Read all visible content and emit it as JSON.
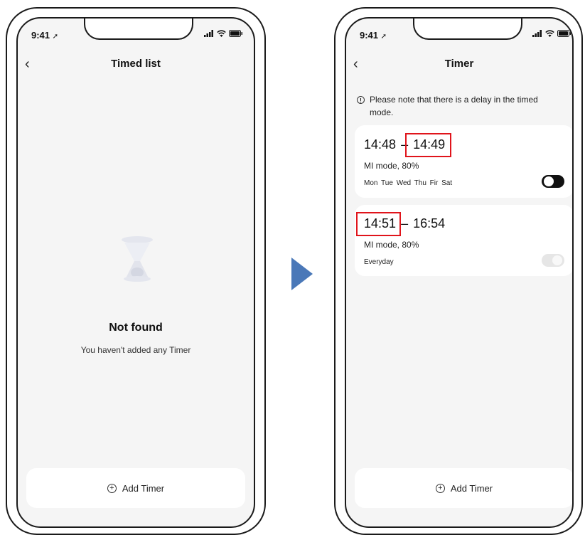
{
  "left_screen": {
    "status_time": "9:41",
    "title": "Timed list",
    "empty_title": "Not found",
    "empty_subtitle": "You haven't added any Timer",
    "add_button_label": "Add Timer"
  },
  "right_screen": {
    "status_time": "9:41",
    "title": "Timer",
    "note": "Please note that there is a delay in the timed mode.",
    "timers": [
      {
        "start": "14:48",
        "separator": "–",
        "end": "14:49",
        "mode": "MI mode,  80%",
        "days": "Mon  Tue  Wed  Thu  Fir  Sat",
        "enabled": true
      },
      {
        "start": "14:51",
        "separator": "–",
        "end": "16:54",
        "mode": "MI mode,  80%",
        "days": "Everyday",
        "enabled": false
      }
    ],
    "add_button_label": "Add Timer"
  },
  "icons": {
    "back": "chevron-left-icon",
    "signal": "signal-icon",
    "wifi": "wifi-icon",
    "battery": "battery-icon",
    "location": "location-arrow-icon",
    "empty_state": "hourglass-icon",
    "note": "info-icon",
    "add": "plus-circle-icon"
  },
  "colors": {
    "highlight": "#e0141b",
    "arrow": "#4a78b8",
    "toggle_on": "#111111",
    "toggle_off": "#e6e6e6",
    "background": "#f5f5f5"
  }
}
